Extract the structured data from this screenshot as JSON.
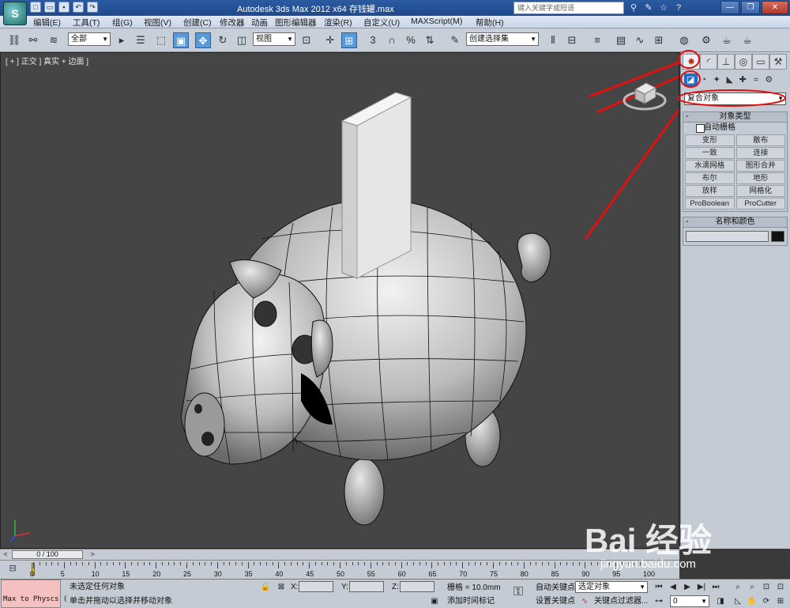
{
  "window": {
    "title": "Autodesk 3ds Max  2012 x64      存钱罐.max",
    "search_placeholder": "键入关键字或短语",
    "app_logo": "S"
  },
  "menu": [
    "编辑(E)",
    "工具(T)",
    "组(G)",
    "视图(V)",
    "创建(C)",
    "修改器",
    "动画",
    "图形编辑器",
    "渲染(R)",
    "自定义(U)",
    "MAXScript(M)",
    "帮助(H)"
  ],
  "toolbar": {
    "selection_filter": "全部",
    "reference_coord": "视图",
    "named_selection": "创建选择集",
    "snap_label": "3",
    "percent_label": "%"
  },
  "viewport": {
    "label": "[ + ] 正交 ] 真实 + 边面 ]",
    "background": "#454545"
  },
  "command_panel": {
    "category_dropdown": "复合对象",
    "object_type_title": "对象类型",
    "autogrid_label": "自动栅格",
    "buttons": [
      "变形",
      "散布",
      "一致",
      "连接",
      "水滴网格",
      "图形合并",
      "布尔",
      "地形",
      "放样",
      "网格化",
      "ProBoolean",
      "ProCutter"
    ],
    "name_color_title": "名称和颜色",
    "swatch_color": "#111111"
  },
  "time_slider": {
    "position_label": "0 / 100"
  },
  "trackbar": {
    "ticks": [
      "0",
      "5",
      "10",
      "15",
      "20",
      "25",
      "30",
      "35",
      "40",
      "45",
      "50",
      "55",
      "60",
      "65",
      "70",
      "75",
      "80",
      "85",
      "90",
      "95",
      "100"
    ]
  },
  "status": {
    "maxscript_text": "Max to Physcs (",
    "selection_status": "未选定任何对象",
    "prompt": "单击并拖动以选择并移动对象",
    "x_label": "X:",
    "y_label": "Y:",
    "z_label": "Z:",
    "grid": "栅格 = 10.0mm",
    "add_time_tag": "添加时间标记",
    "auto_key": "自动关键点",
    "auto_key_sel": "选定对象",
    "set_key": "设置关键点",
    "key_filters": "关键点过滤器...",
    "frame_value": "0"
  },
  "watermark": {
    "brand": "Bai 经验",
    "url": "jingyan.baidu.com"
  },
  "accent_colors": {
    "title_bar": "#2b5aa0",
    "annotation_red": "#e01010",
    "active_tool": "#5a9ad8"
  }
}
